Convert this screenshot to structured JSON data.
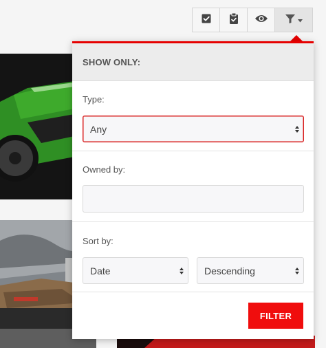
{
  "toolbar": {
    "buttons": [
      {
        "icon": "checkbox-checked-icon"
      },
      {
        "icon": "clipboard-check-icon"
      },
      {
        "icon": "eye-icon"
      },
      {
        "icon": "filter-icon"
      }
    ]
  },
  "filter_panel": {
    "title": "SHOW ONLY:",
    "accent_color": "#e60000",
    "type": {
      "label": "Type:",
      "value": "Any"
    },
    "owned_by": {
      "label": "Owned by:",
      "value": ""
    },
    "sort_by": {
      "label": "Sort by:",
      "field_value": "Date",
      "order_value": "Descending"
    },
    "submit_label": "FILTER"
  }
}
